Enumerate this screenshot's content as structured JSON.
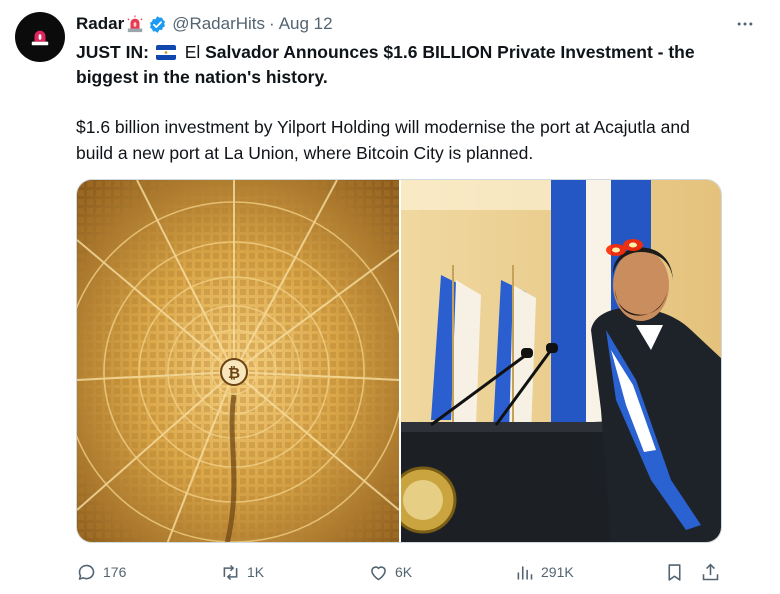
{
  "tweet": {
    "author": {
      "name": "Radar",
      "handle": "@RadarHits",
      "separator": "·",
      "date": "Aug 12"
    },
    "headline": {
      "prefix": "JUST IN:",
      "el": "El",
      "rest": "Salvador Announces $1.6 BILLION Private Investment - the biggest in the nation's history."
    },
    "body": "$1.6 billion investment by Yilport Holding will modernise the port at Acajutla and build  a new port at La Union, where Bitcoin City is planned.",
    "media_logo": "₿",
    "actions": {
      "replies": "176",
      "reposts": "1K",
      "likes": "6K",
      "views": "291K"
    },
    "colors": {
      "verified": "#1d9bf0",
      "muted": "#536471",
      "flag_blue": "#0f47af"
    }
  }
}
